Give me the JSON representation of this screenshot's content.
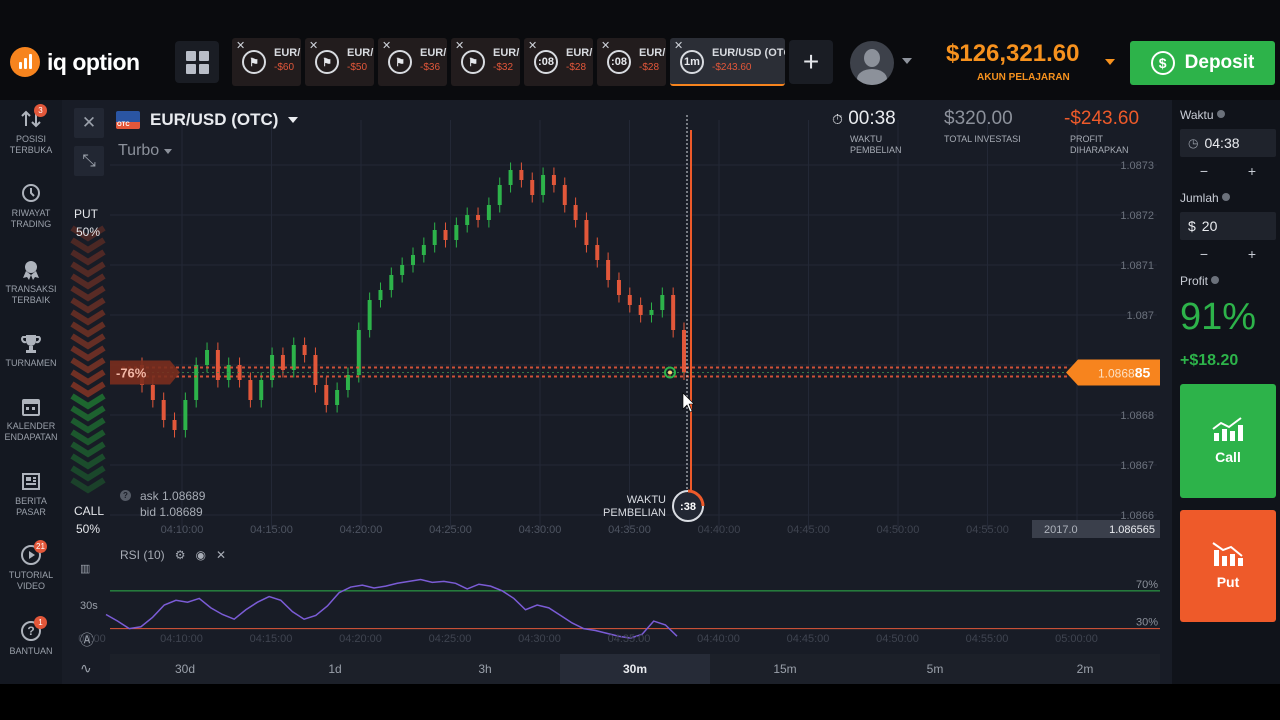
{
  "header": {
    "logo_text": "iq option",
    "tabs": [
      {
        "name": "EUR/",
        "pl": "-$60",
        "icon": "flag",
        "timer": ""
      },
      {
        "name": "EUR/",
        "pl": "-$50",
        "icon": "flag",
        "timer": ""
      },
      {
        "name": "EUR/",
        "pl": "-$36",
        "icon": "flag",
        "timer": ""
      },
      {
        "name": "EUR/",
        "pl": "-$32",
        "icon": "flag",
        "timer": ""
      },
      {
        "name": "EUR/",
        "pl": "-$28",
        "icon": "timer",
        "timer": ":08"
      },
      {
        "name": "EUR/",
        "pl": "-$28",
        "icon": "timer",
        "timer": ":08"
      },
      {
        "name": "EUR/USD (OTC)",
        "pl": "-$243.60",
        "icon": "timer",
        "timer": "1m"
      }
    ],
    "add_tab_label": "+",
    "balance": "$126,321.60",
    "balance_label": "AKUN PELAJARAN",
    "deposit_label": "Deposit",
    "accent_color": "#f7921e",
    "deposit_color": "#2db34a"
  },
  "sidebar": {
    "items": [
      {
        "label1": "POSISI",
        "label2": "TERBUKA",
        "icon": "arrows-icon",
        "badge": "3"
      },
      {
        "label1": "RIWAYAT",
        "label2": "TRADING",
        "icon": "history-icon",
        "badge": ""
      },
      {
        "label1": "TRANSAKSI",
        "label2": "TERBAIK",
        "icon": "award-icon",
        "badge": ""
      },
      {
        "label1": "TURNAMEN",
        "label2": "",
        "icon": "trophy-icon",
        "badge": ""
      },
      {
        "label1": "KALENDER",
        "label2": "ENDAPATAN",
        "icon": "calendar-icon",
        "badge": ""
      },
      {
        "label1": "BERITA",
        "label2": "PASAR",
        "icon": "news-icon",
        "badge": ""
      },
      {
        "label1": "TUTORIAL",
        "label2": "VIDEO",
        "icon": "play-icon",
        "badge": "21"
      },
      {
        "label1": "BANTUAN",
        "label2": "",
        "icon": "help-icon",
        "badge": "1"
      }
    ]
  },
  "chart_header": {
    "asset": "EUR/USD (OTC)",
    "flag_label": "OTC",
    "mode": "Turbo",
    "put_label": "PUT",
    "put_pct": "50%",
    "call_label": "CALL",
    "call_pct": "50%",
    "timer_value": "00:38",
    "timer_label1": "WAKTU",
    "timer_label2": "PEMBELIAN",
    "investment_value": "$320.00",
    "investment_label": "TOTAL INVESTASI",
    "profit_value": "-$243.60",
    "profit_label1": "PROFIT",
    "profit_label2": "DIHARAPKAN",
    "ask": "ask 1.08689",
    "bid": "bid 1.08689",
    "rsi_label": "RSI (10)",
    "purchase_label1": "WAKTU",
    "purchase_label2": "PEMBELIAN",
    "purchase_timer": ":38",
    "current_price": "1.086885",
    "current_price_head": "1.0868",
    "current_price_tail": "85",
    "crosshair_price": "1.086565",
    "crosshair_time": "2017.0",
    "pct_marker": "-76%",
    "rsi_levels": [
      "70%",
      "30%"
    ],
    "lower_tool_label": "30s"
  },
  "periods": [
    {
      "label": "30d",
      "active": false
    },
    {
      "label": "1d",
      "active": false
    },
    {
      "label": "3h",
      "active": false
    },
    {
      "label": "30m",
      "active": true
    },
    {
      "label": "15m",
      "active": false
    },
    {
      "label": "5m",
      "active": false
    },
    {
      "label": "2m",
      "active": false
    }
  ],
  "right_panel": {
    "time_label": "Waktu",
    "time_value": "04:38",
    "amount_label": "Jumlah",
    "amount_currency": "$",
    "amount_value": "20",
    "profit_label": "Profit",
    "profit_pct": "91%",
    "profit_amount": "+$18.20",
    "minus": "−",
    "plus": "+",
    "call_label": "Call",
    "put_label": "Put",
    "call_color": "#2db34a",
    "put_color": "#ee5a2a"
  },
  "chart_data": {
    "type": "candlestick",
    "price_axis": [
      "1.0873",
      "1.0872",
      "1.0871",
      "1.087",
      "1.0869",
      "1.0868",
      "1.0867",
      "1.0866"
    ],
    "price_axis_values": [
      1.0873,
      1.0872,
      1.0871,
      1.087,
      1.0869,
      1.0868,
      1.0867,
      1.0866
    ],
    "time_axis": [
      "04:10:00",
      "04:15:00",
      "04:20:00",
      "04:25:00",
      "04:30:00",
      "04:35:00",
      "04:40:00",
      "04:45:00",
      "04:50:00",
      "04:55:00",
      "05:00:00"
    ],
    "rsi_time_axis": [
      "00:00",
      "04:10:00",
      "04:15:00",
      "04:20:00",
      "04:25:00",
      "04:30:00",
      "04:35:00",
      "04:40:00",
      "04:45:00",
      "04:50:00",
      "04:55:00",
      "05:00:00"
    ],
    "close": [
      1.08686,
      1.08683,
      1.08679,
      1.08677,
      1.08683,
      1.0869,
      1.08693,
      1.08687,
      1.0869,
      1.08687,
      1.08683,
      1.08687,
      1.08692,
      1.08689,
      1.08694,
      1.08692,
      1.08686,
      1.08682,
      1.08685,
      1.08688,
      1.08697,
      1.08703,
      1.08705,
      1.08708,
      1.0871,
      1.08712,
      1.08714,
      1.08717,
      1.08715,
      1.08718,
      1.0872,
      1.08719,
      1.08722,
      1.08726,
      1.08729,
      1.08727,
      1.08724,
      1.08728,
      1.08726,
      1.08722,
      1.08719,
      1.08714,
      1.08711,
      1.08707,
      1.08704,
      1.08702,
      1.087,
      1.08701,
      1.08704,
      1.08697,
      1.086885
    ],
    "open": [
      1.0869,
      1.08686,
      1.08683,
      1.08679,
      1.08677,
      1.08683,
      1.0869,
      1.08693,
      1.08687,
      1.0869,
      1.08687,
      1.08683,
      1.08687,
      1.08692,
      1.08689,
      1.08694,
      1.08692,
      1.08686,
      1.08682,
      1.08685,
      1.08688,
      1.08697,
      1.08703,
      1.08705,
      1.08708,
      1.0871,
      1.08712,
      1.08714,
      1.08717,
      1.08715,
      1.08718,
      1.0872,
      1.08719,
      1.08722,
      1.08726,
      1.08729,
      1.08727,
      1.08724,
      1.08728,
      1.08726,
      1.08722,
      1.08719,
      1.08714,
      1.08711,
      1.08707,
      1.08704,
      1.08702,
      1.087,
      1.08701,
      1.08704,
      1.08697
    ],
    "rsi": [
      45,
      38,
      30,
      32,
      42,
      55,
      60,
      58,
      62,
      52,
      45,
      40,
      50,
      58,
      64,
      60,
      48,
      40,
      44,
      54,
      68,
      74,
      76,
      73,
      75,
      78,
      80,
      82,
      79,
      80,
      78,
      72,
      77,
      75,
      70,
      62,
      50,
      55,
      52,
      44,
      36,
      30,
      28,
      25,
      22,
      20,
      24,
      38,
      34,
      22
    ],
    "rsi_levels": [
      70,
      30
    ],
    "grid": true
  }
}
